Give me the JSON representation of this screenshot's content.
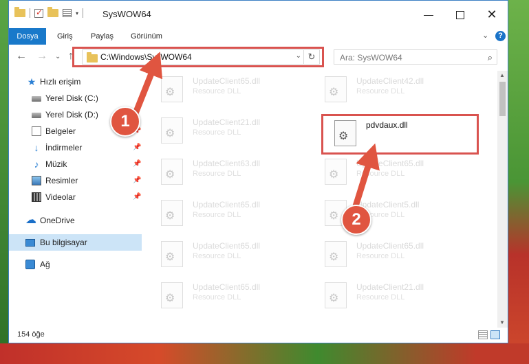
{
  "window": {
    "title": "SysWOW64",
    "minimize": "—",
    "close": "✕"
  },
  "ribbon": {
    "tabs": [
      "Dosya",
      "Giriş",
      "Paylaş",
      "Görünüm"
    ],
    "collapse": "⌄",
    "help": "?"
  },
  "navigation": {
    "back": "←",
    "forward": "→",
    "recent": "⌄",
    "up": "↑",
    "address": "C:\\Windows\\SysWOW64",
    "address_dropdown": "⌄",
    "refresh": "↻",
    "search_placeholder": "Ara: SysWOW64",
    "search_icon": "⌕"
  },
  "sidebar": {
    "items": [
      {
        "label": "Hızlı erişim",
        "icon": "star-icon"
      },
      {
        "label": "Yerel Disk (C:)",
        "icon": "drive-icon"
      },
      {
        "label": "Yerel Disk (D:)",
        "icon": "drive-icon"
      },
      {
        "label": "Belgeler",
        "icon": "document-icon",
        "pinned": true
      },
      {
        "label": "İndirmeler",
        "icon": "download-icon",
        "pinned": true
      },
      {
        "label": "Müzik",
        "icon": "music-icon",
        "pinned": true
      },
      {
        "label": "Resimler",
        "icon": "picture-icon",
        "pinned": true
      },
      {
        "label": "Videolar",
        "icon": "video-icon",
        "pinned": true
      },
      {
        "label": "OneDrive",
        "icon": "cloud-icon"
      },
      {
        "label": "Bu bilgisayar",
        "icon": "computer-icon",
        "selected": true
      },
      {
        "label": "Ağ",
        "icon": "network-icon"
      }
    ],
    "pin_glyph": "📌"
  },
  "files": {
    "left_column": [
      {
        "name": "UpdateClient65.dll",
        "type": "Resource DLL"
      },
      {
        "name": "UpdateClient21.dll",
        "type": "Resource DLL"
      },
      {
        "name": "UpdateClient63.dll",
        "type": "Resource DLL"
      },
      {
        "name": "UpdateClient65.dll",
        "type": "Resource DLL"
      },
      {
        "name": "UpdateClient65.dll",
        "type": "Resource DLL"
      },
      {
        "name": "UpdateClient65.dll",
        "type": "Resource DLL"
      }
    ],
    "right_column": [
      {
        "name": "UpdateClient42.dll",
        "type": "Resource DLL"
      },
      {
        "name": "pdvdaux.dll",
        "type": ""
      },
      {
        "name": "UpdateClient65.dll",
        "type": "Resource DLL"
      },
      {
        "name": "UpdateClient5.dll",
        "type": "Resource DLL"
      },
      {
        "name": "UpdateClient65.dll",
        "type": "Resource DLL"
      },
      {
        "name": "UpdateClient21.dll",
        "type": "Resource DLL"
      }
    ]
  },
  "status": {
    "item_count": "154 öğe"
  },
  "callouts": {
    "step1": "1",
    "step2": "2"
  },
  "colors": {
    "accent": "#1979ca",
    "highlight": "#d9534f",
    "callout": "#e05540",
    "selection": "#cce4f7"
  }
}
